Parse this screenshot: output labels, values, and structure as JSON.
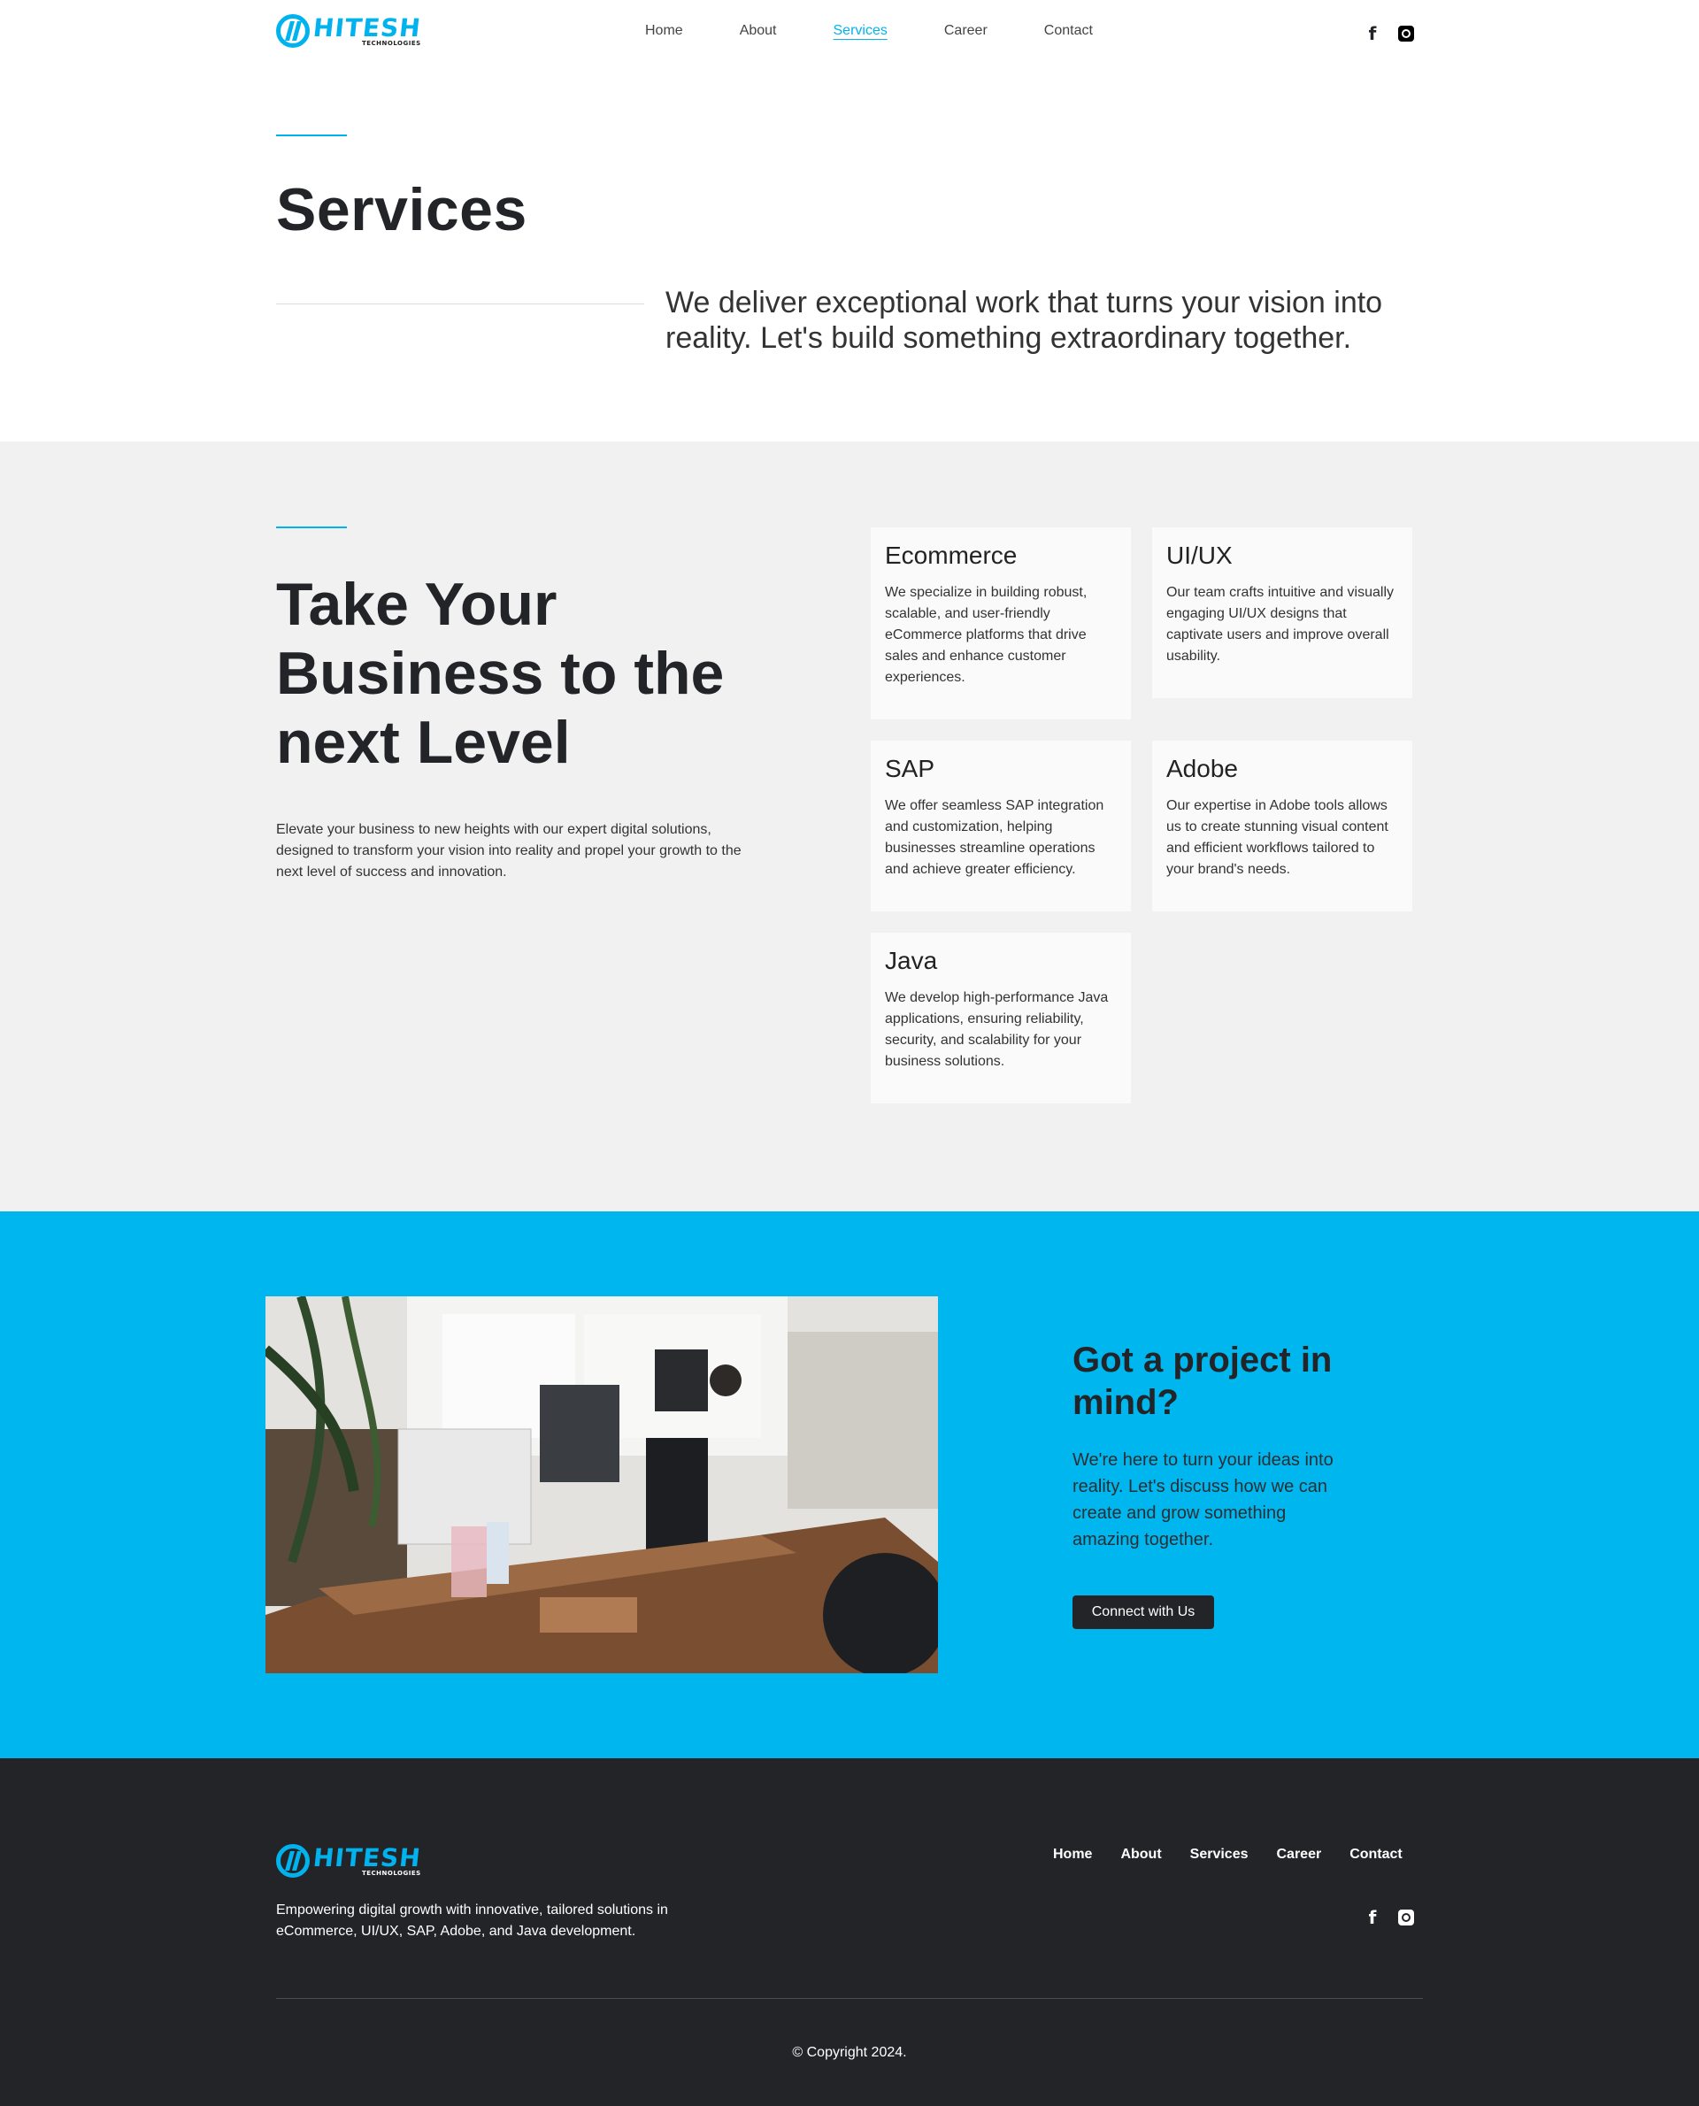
{
  "brand": {
    "name": "HITESH",
    "tagline": "TECHNOLOGIES",
    "accent_color": "#00b3ee",
    "dark_color": "#222428"
  },
  "nav": {
    "items": [
      {
        "label": "Home"
      },
      {
        "label": "About"
      },
      {
        "label": "Services",
        "active": true
      },
      {
        "label": "Career"
      },
      {
        "label": "Contact"
      }
    ]
  },
  "social": {
    "icons": [
      "facebook-icon",
      "instagram-icon"
    ]
  },
  "hero": {
    "title": "Services",
    "description": "We deliver exceptional work that turns your vision into reality. Let's build something extraordinary together."
  },
  "services": {
    "title": "Take Your Business to the next Level",
    "description": "Elevate your business to new heights with our expert digital solutions, designed to transform your vision into reality and propel your growth to the next level of success and innovation.",
    "cards": [
      {
        "title": "Ecommerce",
        "text": "We specialize in building robust, scalable, and user-friendly eCommerce platforms that drive sales and enhance customer experiences."
      },
      {
        "title": "UI/UX",
        "text": "Our team crafts intuitive and visually engaging UI/UX designs that captivate users and improve overall usability."
      },
      {
        "title": "SAP",
        "text": "We offer seamless SAP integration and customization, helping businesses streamline operations and achieve greater efficiency."
      },
      {
        "title": "Adobe",
        "text": "Our expertise in Adobe tools allows us to create stunning visual content and efficient workflows tailored to your brand's needs."
      },
      {
        "title": "Java",
        "text": "We develop high-performance Java applications, ensuring reliability, security, and scalability for your business solutions."
      }
    ]
  },
  "cta": {
    "title": "Got a project in mind?",
    "text": "We're here to turn your ideas into reality. Let's discuss how we can create and grow something amazing together.",
    "button": "Connect with Us",
    "background": "#00b6ee"
  },
  "footer": {
    "text": "Empowering digital growth with innovative, tailored solutions in eCommerce, UI/UX, SAP, Adobe, and Java development.",
    "nav": [
      "Home",
      "About",
      "Services",
      "Career",
      "Contact"
    ],
    "copyright": "© Copyright 2024."
  }
}
